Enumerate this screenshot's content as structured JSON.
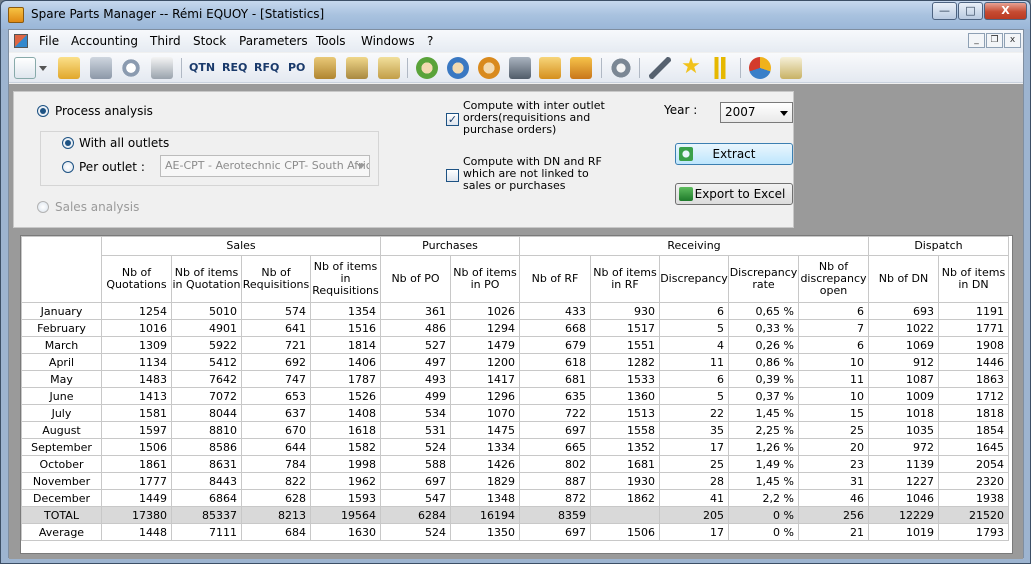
{
  "window": {
    "title": "Spare Parts Manager -- Rémi EQUOY - [Statistics]"
  },
  "caption_buttons": {
    "minimize": "—",
    "maximize": "□",
    "close": "X"
  },
  "menu": [
    "File",
    "Accounting",
    "Third",
    "Stock",
    "Parameters",
    "Tools",
    "Windows",
    "?"
  ],
  "mdi_buttons": {
    "minimize": "_",
    "restore": "❐",
    "close": "x"
  },
  "toolbar": {
    "text_buttons": [
      "QTN",
      "REQ",
      "RFQ",
      "PO"
    ],
    "icons": [
      "new-document-icon",
      "dropdown-arrow-icon",
      "open-folder-icon",
      "save-icon",
      "refresh-icon",
      "print-icon",
      "package-gear-icon",
      "tools-wrench-icon",
      "hand-package-icon",
      "user-green-icon",
      "user-blue-icon",
      "user-orange-icon",
      "pda-icon",
      "home-icon",
      "boxes-icon",
      "settings-gear-icon",
      "wrench-screwdriver-icon",
      "star-icon",
      "chart-bars-icon",
      "pie-chart-icon",
      "notebook-pen-icon"
    ]
  },
  "options": {
    "process_analysis": "Process analysis",
    "with_all_outlets": "With all outlets",
    "per_outlet": "Per outlet :",
    "outlet_value": "AE-CPT - Aerotechnic CPT- South Afric",
    "sales_analysis": "Sales analysis",
    "inter_outlet": "Compute with inter outlet orders(requisitions and purchase orders)",
    "dn_rf": "Compute with DN and RF which are not linked to sales or purchases",
    "year_label": "Year :",
    "year_value": "2007",
    "extract": "Extract",
    "export": "Export to Excel"
  },
  "table": {
    "groups": [
      "Sales",
      "Purchases",
      "Receiving",
      "Dispatch"
    ],
    "columns": [
      "Nb of Quotations",
      "Nb of items in Quotation",
      "Nb of Requisitions",
      "Nb of items in Requisitions",
      "Nb of PO",
      "Nb of items in PO",
      "Nb of RF",
      "Nb of items in RF",
      "Discrepancy",
      "Discrepancy rate",
      "Nb of discrepancy open",
      "Nb of DN",
      "Nb of items in DN"
    ],
    "rows": [
      {
        "month": "January",
        "cells": [
          "1254",
          "5010",
          "574",
          "1354",
          "361",
          "1026",
          "433",
          "930",
          "6",
          "0,65 %",
          "6",
          "693",
          "1191"
        ]
      },
      {
        "month": "February",
        "cells": [
          "1016",
          "4901",
          "641",
          "1516",
          "486",
          "1294",
          "668",
          "1517",
          "5",
          "0,33 %",
          "7",
          "1022",
          "1771"
        ]
      },
      {
        "month": "March",
        "cells": [
          "1309",
          "5922",
          "721",
          "1814",
          "527",
          "1479",
          "679",
          "1551",
          "4",
          "0,26 %",
          "6",
          "1069",
          "1908"
        ]
      },
      {
        "month": "April",
        "cells": [
          "1134",
          "5412",
          "692",
          "1406",
          "497",
          "1200",
          "618",
          "1282",
          "11",
          "0,86 %",
          "10",
          "912",
          "1446"
        ]
      },
      {
        "month": "May",
        "cells": [
          "1483",
          "7642",
          "747",
          "1787",
          "493",
          "1417",
          "681",
          "1533",
          "6",
          "0,39 %",
          "11",
          "1087",
          "1863"
        ]
      },
      {
        "month": "June",
        "cells": [
          "1413",
          "7072",
          "653",
          "1526",
          "499",
          "1296",
          "635",
          "1360",
          "5",
          "0,37 %",
          "10",
          "1009",
          "1712"
        ]
      },
      {
        "month": "July",
        "cells": [
          "1581",
          "8044",
          "637",
          "1408",
          "534",
          "1070",
          "722",
          "1513",
          "22",
          "1,45 %",
          "15",
          "1018",
          "1818"
        ]
      },
      {
        "month": "August",
        "cells": [
          "1597",
          "8810",
          "670",
          "1618",
          "531",
          "1475",
          "697",
          "1558",
          "35",
          "2,25 %",
          "25",
          "1035",
          "1854"
        ]
      },
      {
        "month": "September",
        "cells": [
          "1506",
          "8586",
          "644",
          "1582",
          "524",
          "1334",
          "665",
          "1352",
          "17",
          "1,26 %",
          "20",
          "972",
          "1645"
        ]
      },
      {
        "month": "October",
        "cells": [
          "1861",
          "8631",
          "784",
          "1998",
          "588",
          "1426",
          "802",
          "1681",
          "25",
          "1,49 %",
          "23",
          "1139",
          "2054"
        ]
      },
      {
        "month": "November",
        "cells": [
          "1777",
          "8443",
          "822",
          "1962",
          "697",
          "1829",
          "887",
          "1930",
          "28",
          "1,45 %",
          "31",
          "1227",
          "2320"
        ]
      },
      {
        "month": "December",
        "cells": [
          "1449",
          "6864",
          "628",
          "1593",
          "547",
          "1348",
          "872",
          "1862",
          "41",
          "2,2 %",
          "46",
          "1046",
          "1938"
        ]
      }
    ],
    "total": {
      "month": "TOTAL",
      "cells": [
        "17380",
        "85337",
        "8213",
        "19564",
        "6284",
        "16194",
        "8359",
        "",
        "205",
        "0 %",
        "256",
        "12229",
        "21520"
      ]
    },
    "average": {
      "month": "Average",
      "cells": [
        "1448",
        "7111",
        "684",
        "1630",
        "524",
        "1350",
        "697",
        "1506",
        "17",
        "0 %",
        "21",
        "1019",
        "1793"
      ]
    }
  }
}
